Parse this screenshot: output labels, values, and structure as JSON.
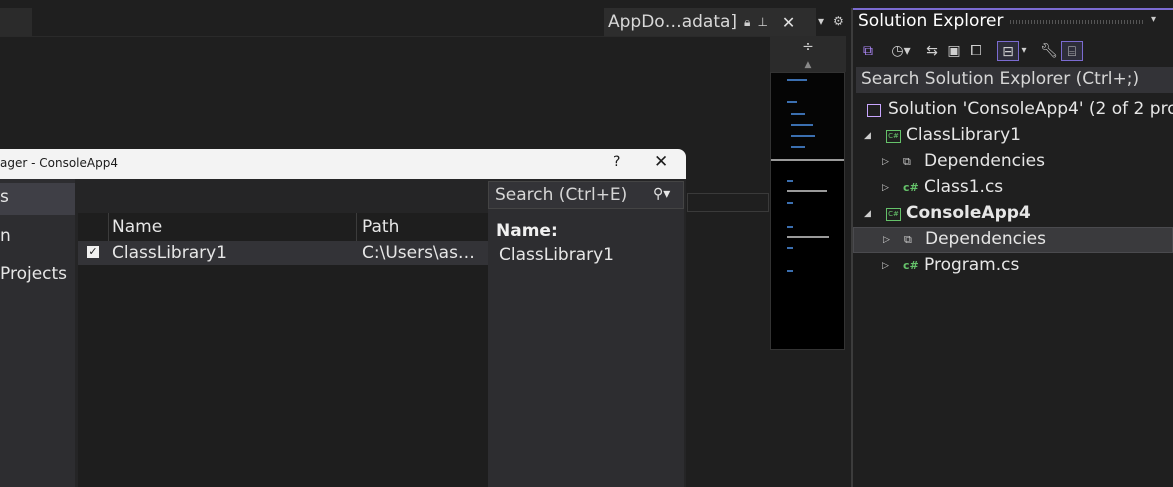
{
  "editor": {
    "doc_tab": {
      "title": "AppDo…adata]",
      "lock_icon": "lock-icon",
      "pin_icon": "pin-icon",
      "close_glyph": "✕"
    },
    "tab_tools": {
      "dropdown": "▾",
      "settings": "⚙"
    },
    "splitter_glyph": "÷"
  },
  "dialog": {
    "title": "ager - ConsoleApp4",
    "help": "?",
    "close": "✕",
    "sidebar": [
      {
        "label": "s",
        "selected": true
      },
      {
        "label": "n",
        "selected": false
      },
      {
        "label": "Projects",
        "selected": false
      }
    ],
    "table": {
      "columns": [
        "Name",
        "Path"
      ],
      "rows": [
        {
          "checked": true,
          "name": "ClassLibrary1",
          "path": "C:\\Users\\as…"
        }
      ]
    },
    "search": {
      "placeholder": "Search (Ctrl+E)",
      "icon": "⚲▾"
    },
    "details": {
      "name_label": "Name:",
      "name_value": "ClassLibrary1"
    }
  },
  "solution_explorer": {
    "title": "Solution Explorer",
    "menu_glyph": "▾",
    "search_placeholder": "Search Solution Explorer (Ctrl+;)",
    "tree": [
      {
        "label": "Solution 'ConsoleApp4' (2 of 2 pro",
        "icon": "solution-icon",
        "level": 0,
        "expander": "",
        "bold": false
      },
      {
        "label": "ClassLibrary1",
        "icon": "project-icon",
        "level": 1,
        "expander": "◢",
        "bold": false
      },
      {
        "label": "Dependencies",
        "icon": "dependencies-icon",
        "level": 2,
        "expander": "▷",
        "bold": false
      },
      {
        "label": "Class1.cs",
        "icon": "csharp-file-icon",
        "level": 2,
        "expander": "▷",
        "bold": false
      },
      {
        "label": "ConsoleApp4",
        "icon": "project-icon",
        "level": 1,
        "expander": "◢",
        "bold": true
      },
      {
        "label": "Dependencies",
        "icon": "dependencies-icon",
        "level": 2,
        "expander": "▷",
        "bold": false,
        "selected": true
      },
      {
        "label": "Program.cs",
        "icon": "csharp-file-icon",
        "level": 2,
        "expander": "▷",
        "bold": false
      }
    ],
    "toolbar_icons": [
      "vs-icon",
      "history-icon",
      "sync-icon",
      "collapse-icon",
      "copy-icon",
      "filter-icon",
      "wrench-icon",
      "preview-icon"
    ]
  }
}
